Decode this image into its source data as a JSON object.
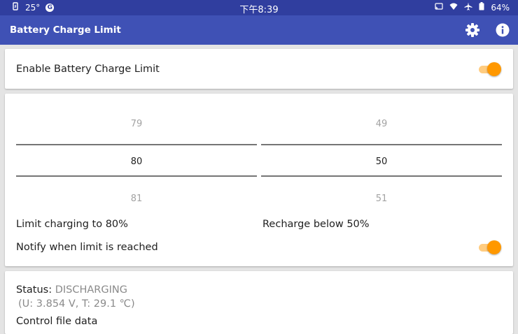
{
  "status_bar": {
    "temperature": "25°",
    "g_badge": "G",
    "time": "下午8:39",
    "battery_percent": "64%"
  },
  "app_bar": {
    "title": "Battery Charge Limit",
    "icons": [
      "gear-icon",
      "info-icon"
    ]
  },
  "enable_card": {
    "label": "Enable Battery Charge Limit",
    "enabled": true
  },
  "limit_card": {
    "limit_picker": {
      "above": "79",
      "selected": "80",
      "below": "81"
    },
    "recharge_picker": {
      "above": "49",
      "selected": "50",
      "below": "51"
    },
    "limit_label": "Limit charging to 80%",
    "recharge_label": "Recharge below 50%",
    "notify_label": "Notify when limit is reached",
    "notify_enabled": true
  },
  "status_card": {
    "status_label": "Status:",
    "status_value": "DISCHARGING",
    "details": "(U: 3.854 V, T: 29.1 ℃)",
    "control_file_label": "Control file data"
  },
  "colors": {
    "status_bar": "#303e9f",
    "app_bar": "#3f51b5",
    "switch_thumb": "#ff9800",
    "switch_track": "#ffcc80",
    "background": "#e4e4e4"
  }
}
